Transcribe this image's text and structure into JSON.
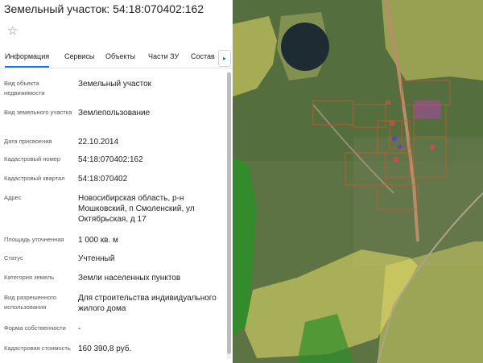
{
  "panel": {
    "title": "Земельный участок: 54:18:070402:162",
    "star_icon": "star-icon",
    "tabs": [
      "Информация",
      "Сервисы",
      "Объекты",
      "Части ЗУ",
      "Состав"
    ],
    "active_tab": "Информация",
    "tab_scroll_icon": "chevron-right-icon",
    "rows": [
      {
        "label": "Вид объекта недвижимости",
        "value": "Земельный участок"
      },
      {
        "label": "Вид земельного участка",
        "value": "Землепользование"
      },
      {
        "label": "Дата присвоения",
        "value": "22.10.2014"
      },
      {
        "label": "Кадастровый номер",
        "value": "54:18:070402:162"
      },
      {
        "label": "Кадастровый квартал",
        "value": "54:18:070402"
      },
      {
        "label": "Адрес",
        "value": "Новосибирская область, р-н Мошковский, п Смоленский, ул Октябрьская, д 17"
      },
      {
        "label": "Площадь уточненная",
        "value": "1 000 кв. м"
      },
      {
        "label": "Статус",
        "value": "Учтенный"
      },
      {
        "label": "Категория земель",
        "value": "Земли населенных пунктов"
      },
      {
        "label": "Вид разрешенного использования",
        "value": "Для строительства индивидуального жилого дома"
      },
      {
        "label": "Форма собственности",
        "value": "-"
      },
      {
        "label": "Кадастровая стоимость",
        "value": "160 390,8 руб."
      }
    ]
  },
  "map": {
    "kind": "satellite imagery with cadastral overlays",
    "colors": {
      "zone_yellow": "#e8e06a",
      "zone_green": "#3fae3f",
      "parcel_outline": "#d4572f",
      "selected_parcel": "#c040c0"
    }
  }
}
